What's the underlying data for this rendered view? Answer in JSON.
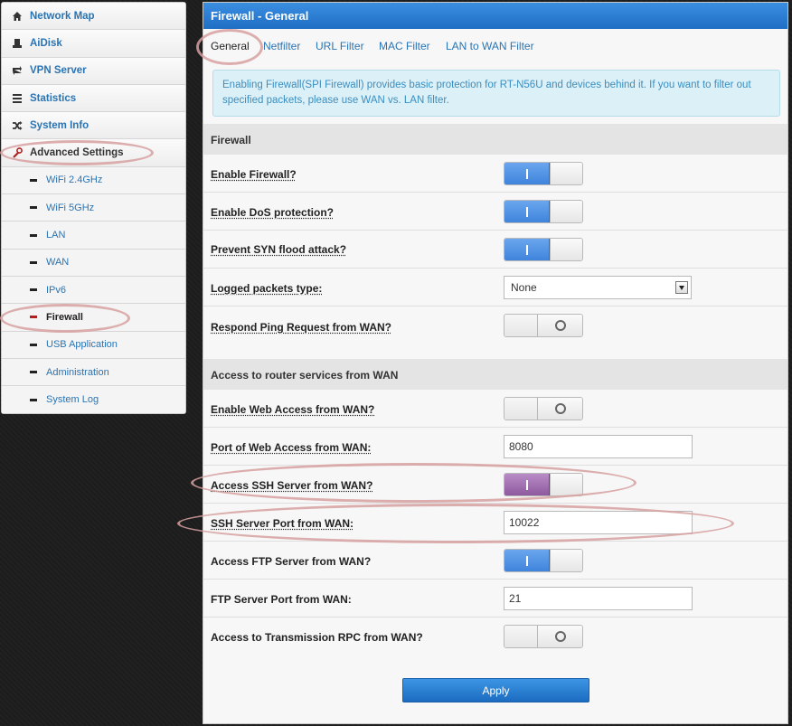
{
  "sidebar": {
    "items": [
      {
        "label": "Network Map",
        "icon": "home-icon"
      },
      {
        "label": "AiDisk",
        "icon": "drive-icon"
      },
      {
        "label": "VPN Server",
        "icon": "vpn-icon"
      },
      {
        "label": "Statistics",
        "icon": "list-icon"
      },
      {
        "label": "System Info",
        "icon": "shuffle-icon"
      },
      {
        "label": "Advanced Settings",
        "icon": "wrench-icon"
      }
    ],
    "subitems": [
      "WiFi 2.4GHz",
      "WiFi 5GHz",
      "LAN",
      "WAN",
      "IPv6",
      "Firewall",
      "USB Application",
      "Administration",
      "System Log"
    ],
    "active_subitem": "Firewall"
  },
  "page": {
    "title": "Firewall - General",
    "tabs": [
      "General",
      "Netfilter",
      "URL Filter",
      "MAC Filter",
      "LAN to WAN Filter"
    ],
    "active_tab": "General",
    "info_text": "Enabling Firewall(SPI Firewall) provides basic protection for RT-N56U and devices behind it. If you want to filter out specified packets, please use WAN vs. LAN filter."
  },
  "firewall": {
    "heading": "Firewall",
    "enable_firewall": {
      "label": "Enable Firewall?",
      "value": true
    },
    "enable_dos": {
      "label": "Enable DoS protection?",
      "value": true
    },
    "prevent_syn": {
      "label": "Prevent SYN flood attack?",
      "value": true
    },
    "logged_packets": {
      "label": "Logged packets type:",
      "value": "None"
    },
    "respond_ping": {
      "label": "Respond Ping Request from WAN?",
      "value": false
    }
  },
  "access": {
    "heading": "Access to router services from WAN",
    "web_access": {
      "label": "Enable Web Access from WAN?",
      "value": false
    },
    "web_port": {
      "label": "Port of Web Access from WAN:",
      "value": "8080"
    },
    "ssh_access": {
      "label": "Access SSH Server from WAN?",
      "value": true
    },
    "ssh_port": {
      "label": "SSH Server Port from WAN:",
      "value": "10022"
    },
    "ftp_access": {
      "label": "Access FTP Server from WAN?",
      "value": true
    },
    "ftp_port": {
      "label": "FTP Server Port from WAN:",
      "value": "21"
    },
    "transmission": {
      "label": "Access to Transmission RPC from WAN?",
      "value": false
    }
  },
  "apply_label": "Apply",
  "colors": {
    "accent": "#1f6fc4",
    "link": "#2a74b3",
    "highlight": "#d7a0a0"
  }
}
